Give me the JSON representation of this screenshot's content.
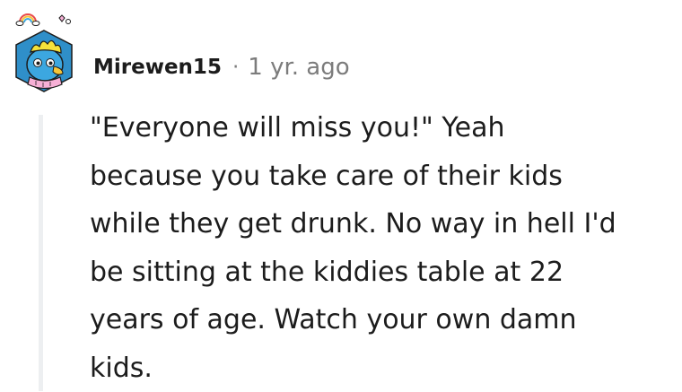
{
  "comment": {
    "author": "Mirewen15",
    "separator": "·",
    "timestamp": "1 yr. ago",
    "body": "\"Everyone will miss you!\" Yeah\nbecause you take care of their kids\nwhile they get drunk. No way in hell I'd\nbe sitting at the kiddies table at 22\nyears of age. Watch your own damn\nkids."
  },
  "colors": {
    "text": "#1c1c1c",
    "meta": "#7c7c7c",
    "thread_line": "#edeff1",
    "avatar_bg": "#2f8fc9",
    "avatar_face": "#3ca7e0",
    "avatar_hair": "#f6e23a",
    "avatar_scarf": "#f7b0d6"
  },
  "icons": {
    "avatar": "snoo-avatar-icon",
    "decoration": "rainbow-cloud-icon"
  }
}
